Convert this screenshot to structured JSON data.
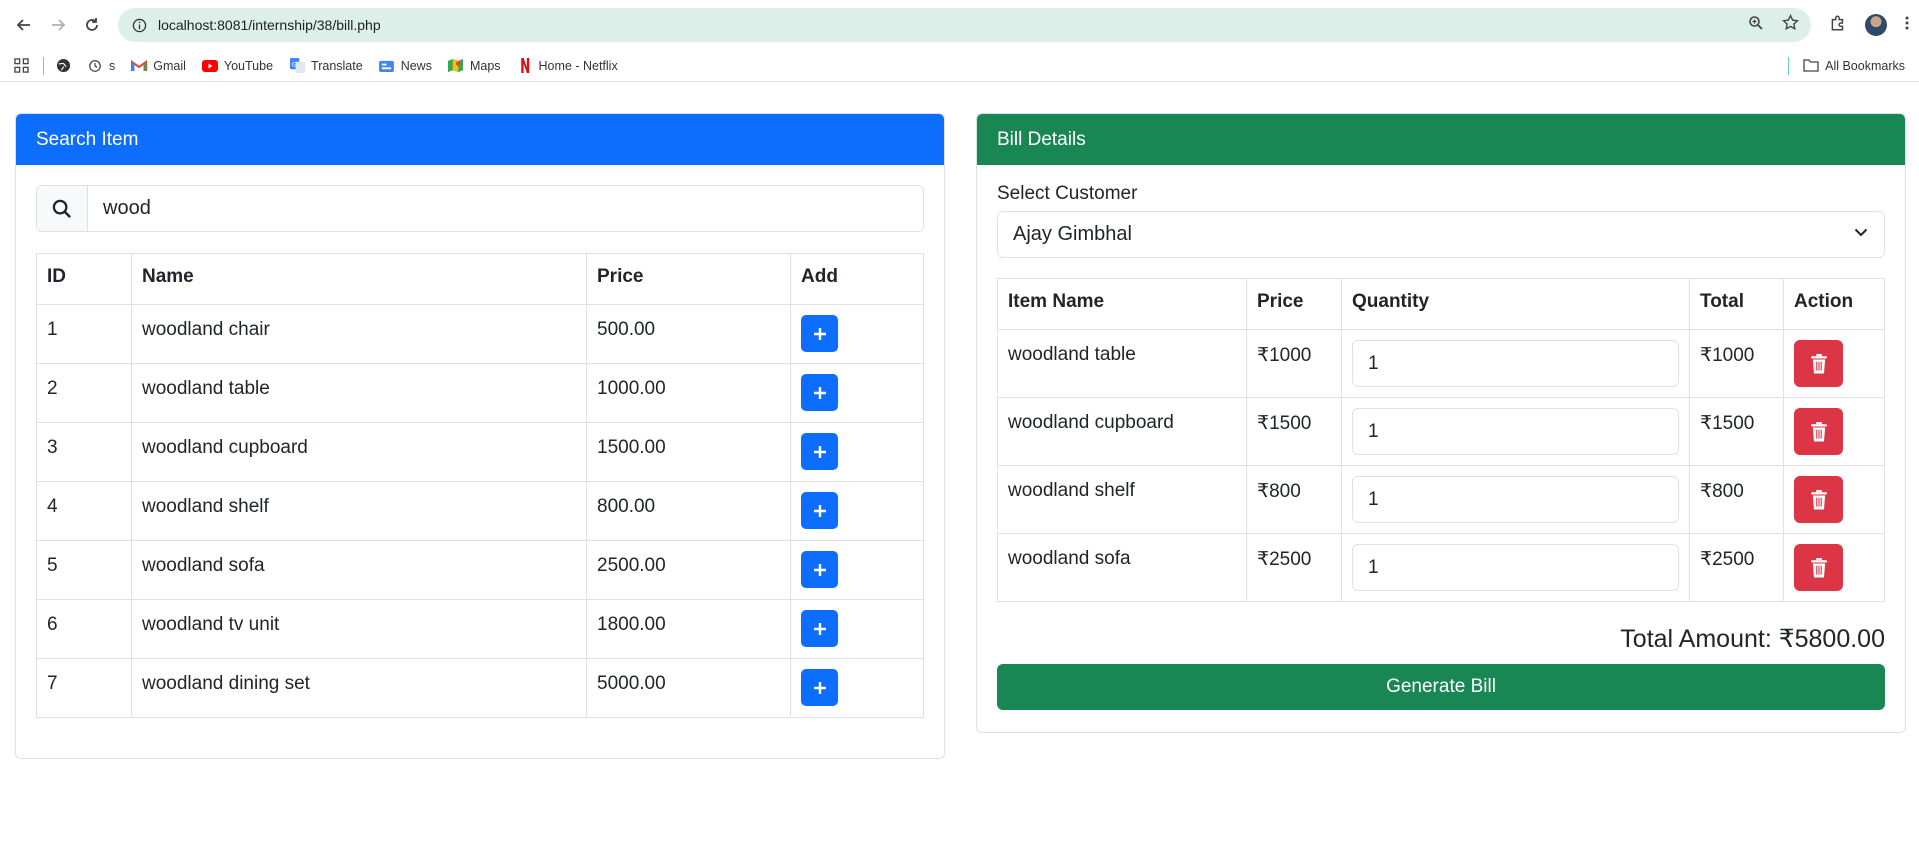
{
  "browser": {
    "url": "localhost:8081/internship/38/bill.php",
    "bookmarks": [
      {
        "label": "s",
        "icon": "history-icon"
      },
      {
        "label": "Gmail",
        "icon": "gmail-icon"
      },
      {
        "label": "YouTube",
        "icon": "youtube-icon"
      },
      {
        "label": "Translate",
        "icon": "translate-icon"
      },
      {
        "label": "News",
        "icon": "news-icon"
      },
      {
        "label": "Maps",
        "icon": "maps-icon"
      },
      {
        "label": "Home - Netflix",
        "icon": "netflix-icon"
      }
    ],
    "all_bookmarks": "All Bookmarks"
  },
  "search_card": {
    "title": "Search Item",
    "search_value": "wood",
    "columns": [
      "ID",
      "Name",
      "Price",
      "Add"
    ],
    "items": [
      {
        "id": "1",
        "name": "woodland chair",
        "price": "500.00"
      },
      {
        "id": "2",
        "name": "woodland table",
        "price": "1000.00"
      },
      {
        "id": "3",
        "name": "woodland cupboard",
        "price": "1500.00"
      },
      {
        "id": "4",
        "name": "woodland shelf",
        "price": "800.00"
      },
      {
        "id": "5",
        "name": "woodland sofa",
        "price": "2500.00"
      },
      {
        "id": "6",
        "name": "woodland tv unit",
        "price": "1800.00"
      },
      {
        "id": "7",
        "name": "woodland dining set",
        "price": "5000.00"
      }
    ]
  },
  "bill_card": {
    "title": "Bill Details",
    "customer_label": "Select Customer",
    "customer_value": "Ajay Gimbhal",
    "columns": [
      "Item Name",
      "Price",
      "Quantity",
      "Total",
      "Action"
    ],
    "rows": [
      {
        "name": "woodland table",
        "price": "₹1000",
        "qty": "1",
        "total": "₹1000"
      },
      {
        "name": "woodland cupboard",
        "price": "₹1500",
        "qty": "1",
        "total": "₹1500"
      },
      {
        "name": "woodland shelf",
        "price": "₹800",
        "qty": "1",
        "total": "₹800"
      },
      {
        "name": "woodland sofa",
        "price": "₹2500",
        "qty": "1",
        "total": "₹2500"
      }
    ],
    "total_text": "Total Amount: ₹5800.00",
    "generate_label": "Generate Bill"
  },
  "colors": {
    "primary": "#0d6efd",
    "success": "#198754",
    "danger": "#dc3545"
  }
}
